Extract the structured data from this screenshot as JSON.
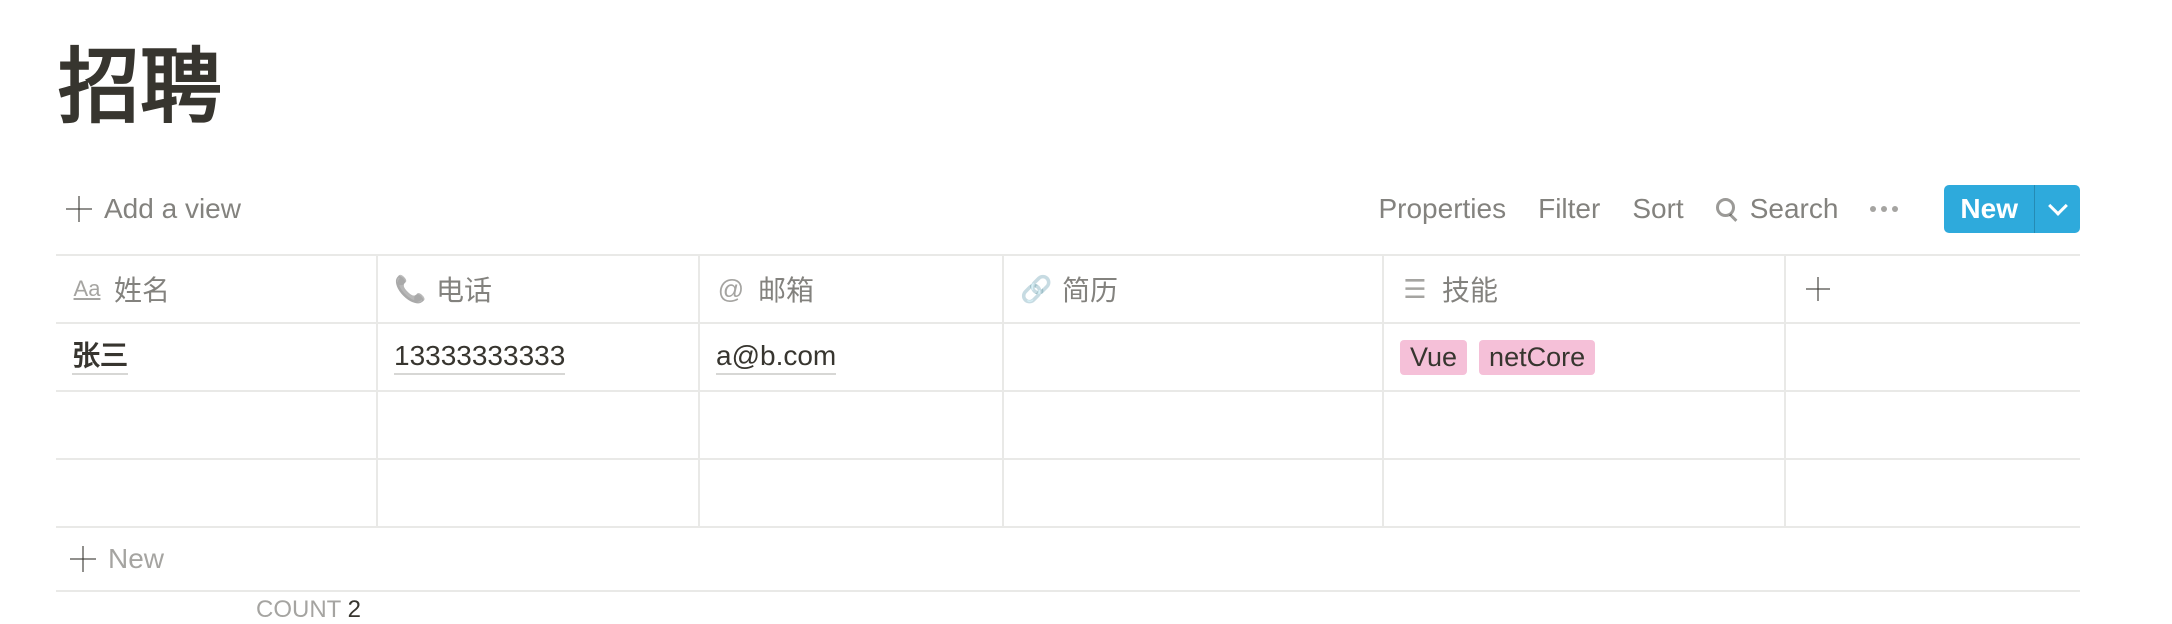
{
  "page": {
    "title": "招聘"
  },
  "toolbar": {
    "add_view": "Add a view",
    "properties": "Properties",
    "filter": "Filter",
    "sort": "Sort",
    "search": "Search",
    "new_label": "New"
  },
  "table": {
    "columns": [
      {
        "icon": "Aa",
        "label": "姓名"
      },
      {
        "icon": "📞",
        "label": "电话"
      },
      {
        "icon": "@",
        "label": "邮箱"
      },
      {
        "icon": "🔗",
        "label": "简历"
      },
      {
        "icon": "☰",
        "label": "技能"
      }
    ],
    "rows": [
      {
        "name": "张三",
        "phone": "13333333333",
        "email": "a@b.com",
        "resume": "",
        "skills": [
          "Vue",
          "netCore"
        ]
      }
    ],
    "new_row_label": "New",
    "count_label": "COUNT",
    "count_value": "2"
  },
  "colors": {
    "accent": "#2eaadc",
    "tag": "#f5c0d8"
  }
}
